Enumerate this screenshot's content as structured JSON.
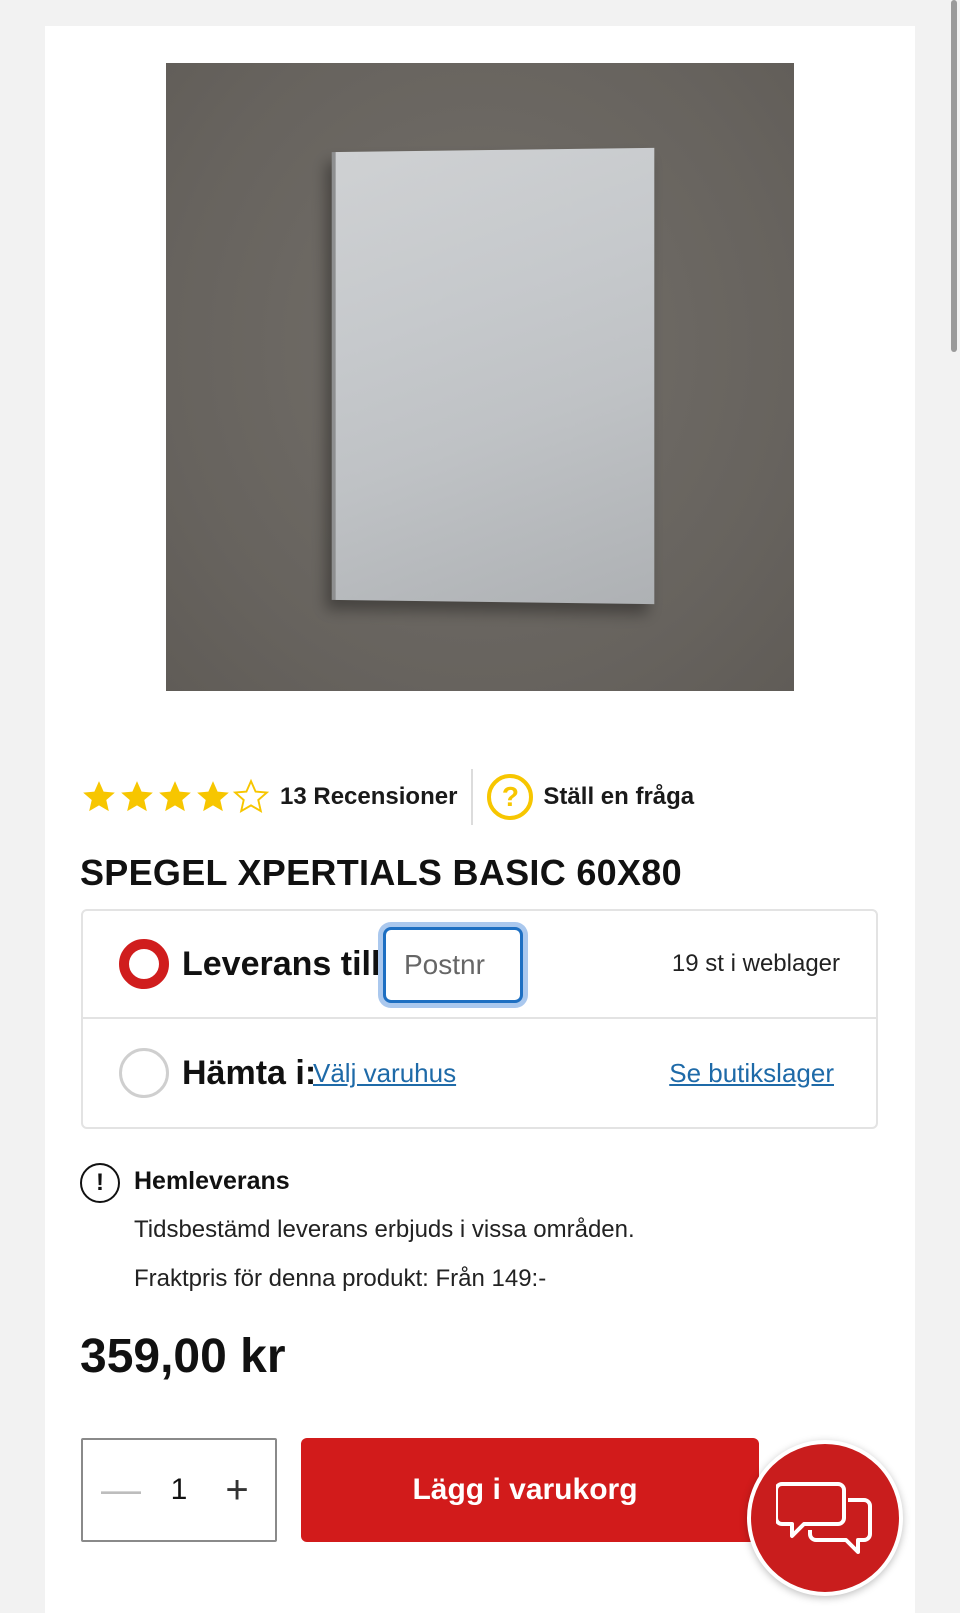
{
  "product": {
    "title": "SPEGEL XPERTIALS BASIC 60X80",
    "rating": 4,
    "rating_max": 5,
    "reviews_label": "13 Recensioner",
    "ask_label": "Ställ en fråga",
    "price": "359,00 kr"
  },
  "delivery": {
    "ship_label": "Leverans till:",
    "postcode_placeholder": "Postnr",
    "postcode_value": "",
    "stock_text": "19 st i weblager",
    "pickup_label": "Hämta i:",
    "choose_store_link": "Välj varuhus",
    "store_stock_link": "Se butikslager"
  },
  "info": {
    "title": "Hemleverans",
    "line1": "Tidsbestämd leverans erbjuds i vissa områden.",
    "line2": "Fraktpris för denna produkt: Från 149:-"
  },
  "cart": {
    "quantity": "1",
    "minus_symbol": "—",
    "plus_symbol": "+",
    "add_label": "Lägg i varukorg"
  },
  "colors": {
    "accent": "#d21b1b",
    "star": "#f7c600",
    "link": "#1e6aa8"
  }
}
